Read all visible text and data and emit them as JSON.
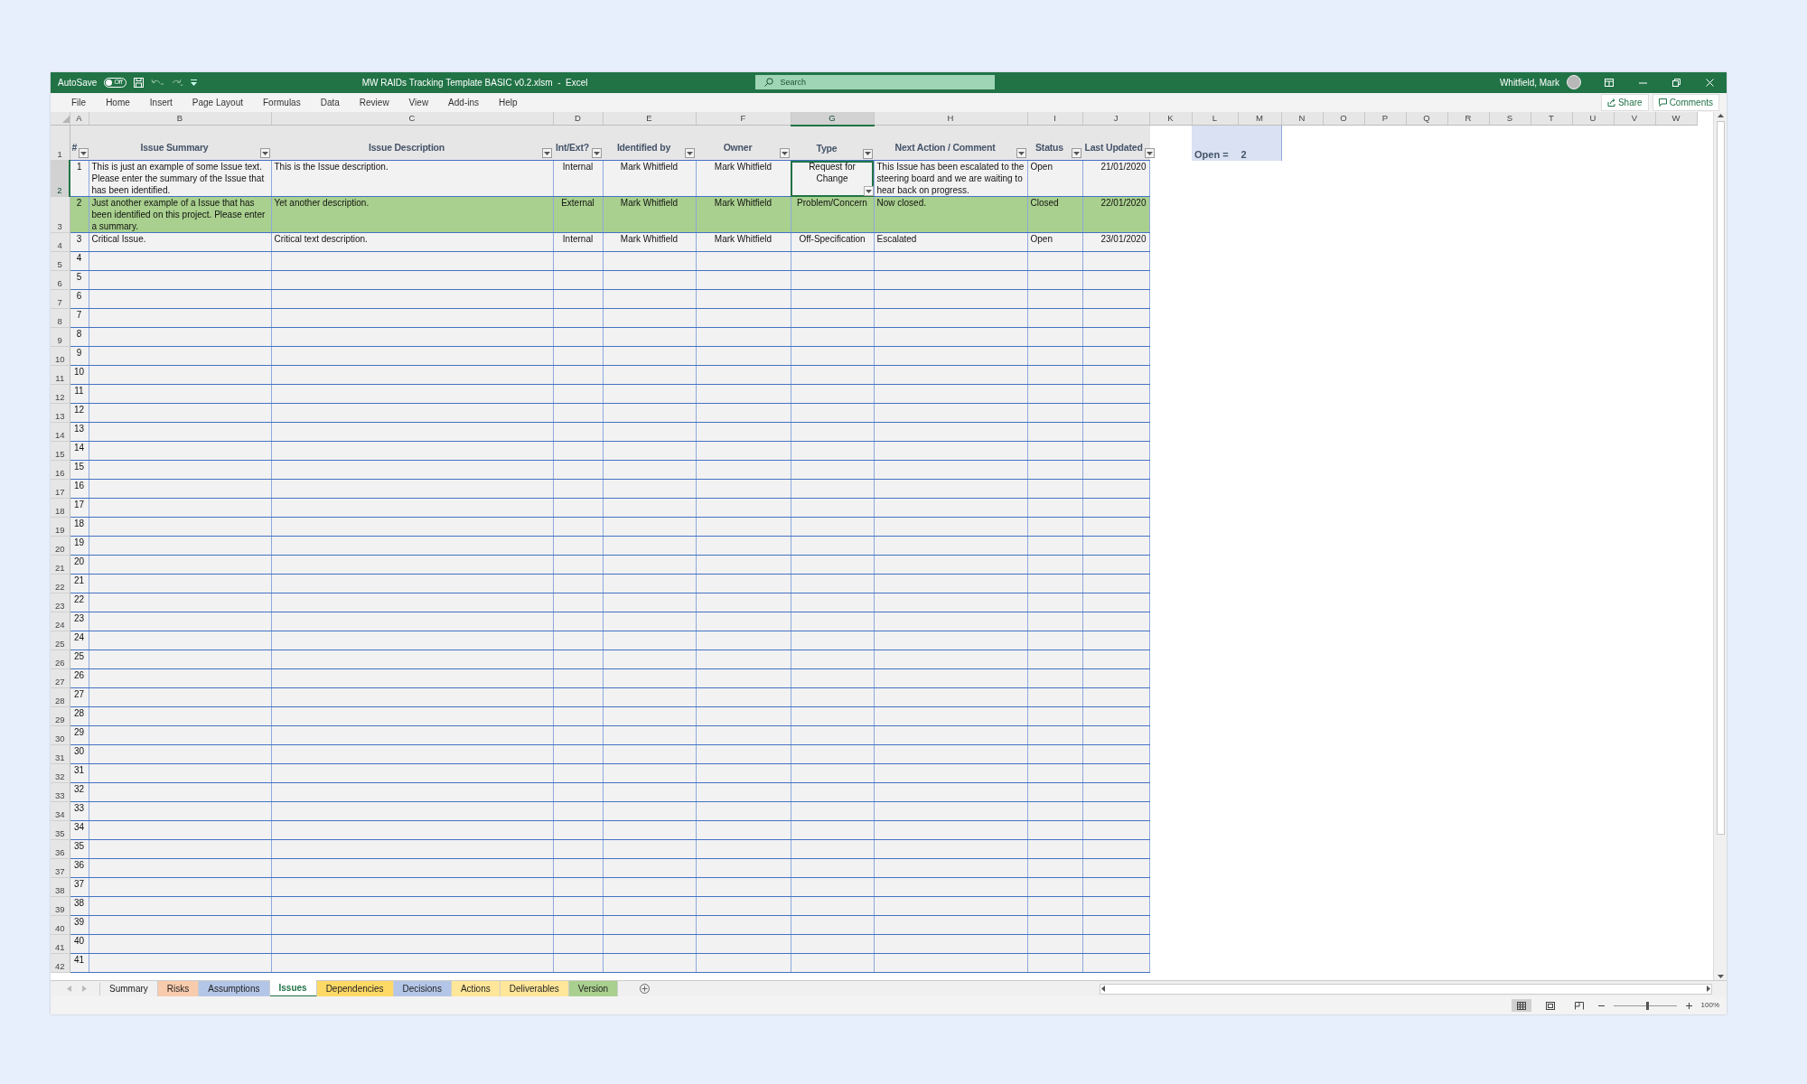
{
  "title_bar": {
    "autosave_label": "AutoSave",
    "autosave_on": false,
    "autosave_state": "Off",
    "title": "MW RAIDs Tracking Template BASIC v0.2.xlsm  -  Excel",
    "search_placeholder": "Search",
    "user": "Whitfield, Mark"
  },
  "menu": [
    {
      "label": "File"
    },
    {
      "label": "Home"
    },
    {
      "label": "Insert"
    },
    {
      "label": "Page Layout"
    },
    {
      "label": "Formulas"
    },
    {
      "label": "Data"
    },
    {
      "label": "Review"
    },
    {
      "label": "View"
    },
    {
      "label": "Add-ins"
    },
    {
      "label": "Help"
    }
  ],
  "share": "Share",
  "comments": "Comments",
  "column_letters": [
    {
      "letter": "A",
      "selected": false
    },
    {
      "letter": "B",
      "selected": false
    },
    {
      "letter": "C",
      "selected": false
    },
    {
      "letter": "D",
      "selected": false
    },
    {
      "letter": "E",
      "selected": false
    },
    {
      "letter": "F",
      "selected": false
    },
    {
      "letter": "G",
      "selected": true
    },
    {
      "letter": "H",
      "selected": false
    },
    {
      "letter": "I",
      "selected": false
    },
    {
      "letter": "J",
      "selected": false
    },
    {
      "letter": "K",
      "selected": false
    },
    {
      "letter": "L",
      "selected": false
    },
    {
      "letter": "M",
      "selected": false
    },
    {
      "letter": "N",
      "selected": false
    },
    {
      "letter": "O",
      "selected": false
    },
    {
      "letter": "P",
      "selected": false
    },
    {
      "letter": "Q",
      "selected": false
    },
    {
      "letter": "R",
      "selected": false
    },
    {
      "letter": "S",
      "selected": false
    },
    {
      "letter": "T",
      "selected": false
    },
    {
      "letter": "U",
      "selected": false
    },
    {
      "letter": "V",
      "selected": false
    },
    {
      "letter": "W",
      "selected": false
    }
  ],
  "header_row_number": "1",
  "table": {
    "columns": [
      {
        "title": "#"
      },
      {
        "title": "Issue Summary"
      },
      {
        "title": "Issue Description"
      },
      {
        "title": "Int/Ext?"
      },
      {
        "title": "Identified by"
      },
      {
        "title": "Owner"
      },
      {
        "title": "Type"
      },
      {
        "title": "Next Action / Comment"
      },
      {
        "title": "Status"
      },
      {
        "title": "Last Updated"
      }
    ],
    "rows": [
      {
        "row_number": "2",
        "selected": true,
        "highlighted": false,
        "cells": [
          "1",
          "This is just an example of some Issue text. Please enter the summary of the Issue that has been identified.",
          "This is the Issue description.",
          "Internal",
          "Mark Whitfield",
          "Mark Whitfield",
          "Request for Change",
          "This Issue has been escalated to the steering board and we are waiting to hear back on progress.",
          "Open",
          "21/01/2020"
        ]
      },
      {
        "row_number": "3",
        "selected": false,
        "highlighted": true,
        "cells": [
          "2",
          "Just another example of a Issue that has been identified on this project. Please enter a summary.",
          "Yet another description.",
          "External",
          "Mark Whitfield",
          "Mark Whitfield",
          "Problem/Concern",
          "Now closed.",
          "Closed",
          "22/01/2020"
        ]
      },
      {
        "row_number": "4",
        "selected": false,
        "highlighted": false,
        "cells": [
          "3",
          "Critical Issue.",
          "Critical text description.",
          "Internal",
          "Mark Whitfield",
          "Mark Whitfield",
          "Off-Specification",
          "Escalated",
          "Open",
          "23/01/2020"
        ]
      },
      {
        "row_number": "5",
        "selected": false,
        "highlighted": false,
        "cells": [
          "4"
        ]
      },
      {
        "row_number": "6",
        "selected": false,
        "highlighted": false,
        "cells": [
          "5"
        ]
      },
      {
        "row_number": "7",
        "selected": false,
        "highlighted": false,
        "cells": [
          "6"
        ]
      },
      {
        "row_number": "8",
        "selected": false,
        "highlighted": false,
        "cells": [
          "7"
        ]
      },
      {
        "row_number": "9",
        "selected": false,
        "highlighted": false,
        "cells": [
          "8"
        ]
      },
      {
        "row_number": "10",
        "selected": false,
        "highlighted": false,
        "cells": [
          "9"
        ]
      },
      {
        "row_number": "11",
        "selected": false,
        "highlighted": false,
        "cells": [
          "10"
        ]
      },
      {
        "row_number": "12",
        "selected": false,
        "highlighted": false,
        "cells": [
          "11"
        ]
      },
      {
        "row_number": "13",
        "selected": false,
        "highlighted": false,
        "cells": [
          "12"
        ]
      },
      {
        "row_number": "14",
        "selected": false,
        "highlighted": false,
        "cells": [
          "13"
        ]
      },
      {
        "row_number": "15",
        "selected": false,
        "highlighted": false,
        "cells": [
          "14"
        ]
      },
      {
        "row_number": "16",
        "selected": false,
        "highlighted": false,
        "cells": [
          "15"
        ]
      },
      {
        "row_number": "17",
        "selected": false,
        "highlighted": false,
        "cells": [
          "16"
        ]
      },
      {
        "row_number": "18",
        "selected": false,
        "highlighted": false,
        "cells": [
          "17"
        ]
      },
      {
        "row_number": "19",
        "selected": false,
        "highlighted": false,
        "cells": [
          "18"
        ]
      },
      {
        "row_number": "20",
        "selected": false,
        "highlighted": false,
        "cells": [
          "19"
        ]
      },
      {
        "row_number": "21",
        "selected": false,
        "highlighted": false,
        "cells": [
          "20"
        ]
      },
      {
        "row_number": "22",
        "selected": false,
        "highlighted": false,
        "cells": [
          "21"
        ]
      },
      {
        "row_number": "23",
        "selected": false,
        "highlighted": false,
        "cells": [
          "22"
        ]
      },
      {
        "row_number": "24",
        "selected": false,
        "highlighted": false,
        "cells": [
          "23"
        ]
      },
      {
        "row_number": "25",
        "selected": false,
        "highlighted": false,
        "cells": [
          "24"
        ]
      },
      {
        "row_number": "26",
        "selected": false,
        "highlighted": false,
        "cells": [
          "25"
        ]
      },
      {
        "row_number": "27",
        "selected": false,
        "highlighted": false,
        "cells": [
          "26"
        ]
      },
      {
        "row_number": "28",
        "selected": false,
        "highlighted": false,
        "cells": [
          "27"
        ]
      },
      {
        "row_number": "29",
        "selected": false,
        "highlighted": false,
        "cells": [
          "28"
        ]
      },
      {
        "row_number": "30",
        "selected": false,
        "highlighted": false,
        "cells": [
          "29"
        ]
      },
      {
        "row_number": "31",
        "selected": false,
        "highlighted": false,
        "cells": [
          "30"
        ]
      },
      {
        "row_number": "32",
        "selected": false,
        "highlighted": false,
        "cells": [
          "31"
        ]
      },
      {
        "row_number": "33",
        "selected": false,
        "highlighted": false,
        "cells": [
          "32"
        ]
      },
      {
        "row_number": "34",
        "selected": false,
        "highlighted": false,
        "cells": [
          "33"
        ]
      },
      {
        "row_number": "35",
        "selected": false,
        "highlighted": false,
        "cells": [
          "34"
        ]
      },
      {
        "row_number": "36",
        "selected": false,
        "highlighted": false,
        "cells": [
          "35"
        ]
      },
      {
        "row_number": "37",
        "selected": false,
        "highlighted": false,
        "cells": [
          "36"
        ]
      },
      {
        "row_number": "38",
        "selected": false,
        "highlighted": false,
        "cells": [
          "37"
        ]
      },
      {
        "row_number": "39",
        "selected": false,
        "highlighted": false,
        "cells": [
          "38"
        ]
      },
      {
        "row_number": "40",
        "selected": false,
        "highlighted": false,
        "cells": [
          "39"
        ]
      },
      {
        "row_number": "41",
        "selected": false,
        "highlighted": false,
        "cells": [
          "40"
        ]
      },
      {
        "row_number": "42",
        "selected": false,
        "highlighted": false,
        "cells": [
          "41"
        ]
      }
    ]
  },
  "summary": {
    "label": "Open =",
    "value": "2"
  },
  "sheet_tabs": [
    {
      "label": "Summary",
      "selected": false
    },
    {
      "label": "Risks",
      "color": "#f8cbad",
      "selected": false
    },
    {
      "label": "Assumptions",
      "color": "#b4c6e7",
      "selected": false
    },
    {
      "label": "Issues",
      "selected": true
    },
    {
      "label": "Dependencies",
      "color": "#ffd966",
      "selected": false
    },
    {
      "label": "Decisions",
      "color": "#b4c6e7",
      "selected": false
    },
    {
      "label": "Actions",
      "color": "#ffe699",
      "selected": false
    },
    {
      "label": "Deliverables",
      "color": "#ffe699",
      "selected": false
    },
    {
      "label": "Version",
      "color": "#a9d08e",
      "selected": false
    }
  ],
  "status_bar": {
    "zoom_slider": {
      "level": 0.52
    },
    "zoom_label": "100%"
  }
}
